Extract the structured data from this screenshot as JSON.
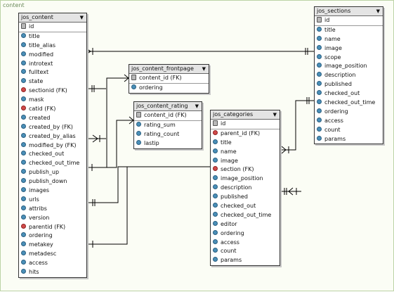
{
  "canvas": {
    "label": "content"
  },
  "colors": {
    "field_icon": "#4a8fb8",
    "fk_icon": "#d04a4a",
    "key_icon": "#b8b8b8",
    "line": "#000000"
  },
  "tables": {
    "jos_content": {
      "title": "jos_content",
      "fields": [
        "id",
        "title",
        "title_alias",
        "modified",
        "introtext",
        "fulltext",
        "state",
        "sectionid (FK)",
        "mask",
        "catid (FK)",
        "created",
        "created_by (FK)",
        "created_by_alias",
        "modified_by (FK)",
        "checked_out",
        "checked_out_time",
        "publish_up",
        "publish_down",
        "images",
        "urls",
        "attribs",
        "version",
        "parentid (FK)",
        "ordering",
        "metakey",
        "metadesc",
        "access",
        "hits"
      ],
      "kinds": [
        "key",
        "field",
        "field",
        "field",
        "field",
        "field",
        "field",
        "fk",
        "field",
        "fk",
        "field",
        "field",
        "field",
        "field",
        "field",
        "field",
        "field",
        "field",
        "field",
        "field",
        "field",
        "field",
        "fk",
        "field",
        "field",
        "field",
        "field",
        "field"
      ]
    },
    "jos_sections": {
      "title": "jos_sections",
      "fields": [
        "id",
        "title",
        "name",
        "image",
        "scope",
        "image_position",
        "description",
        "published",
        "checked_out",
        "checked_out_time",
        "ordering",
        "access",
        "count",
        "params"
      ],
      "kinds": [
        "key",
        "field",
        "field",
        "field",
        "field",
        "field",
        "field",
        "field",
        "field",
        "field",
        "field",
        "field",
        "field",
        "field"
      ]
    },
    "jos_content_frontpage": {
      "title": "jos_content_frontpage",
      "fields": [
        "content_id (FK)",
        "ordering"
      ],
      "kinds": [
        "key",
        "field"
      ]
    },
    "jos_content_rating": {
      "title": "jos_content_rating",
      "fields": [
        "content_id (FK)",
        "rating_sum",
        "rating_count",
        "lastip"
      ],
      "kinds": [
        "key",
        "field",
        "field",
        "field"
      ]
    },
    "jos_categories": {
      "title": "jos_categories",
      "fields": [
        "id",
        "parent_id (FK)",
        "title",
        "name",
        "image",
        "section (FK)",
        "image_position",
        "description",
        "published",
        "checked_out",
        "checked_out_time",
        "editor",
        "ordering",
        "access",
        "count",
        "params"
      ],
      "kinds": [
        "key",
        "fk",
        "field",
        "field",
        "field",
        "fk",
        "field",
        "field",
        "field",
        "field",
        "field",
        "field",
        "field",
        "field",
        "field",
        "field"
      ]
    }
  }
}
